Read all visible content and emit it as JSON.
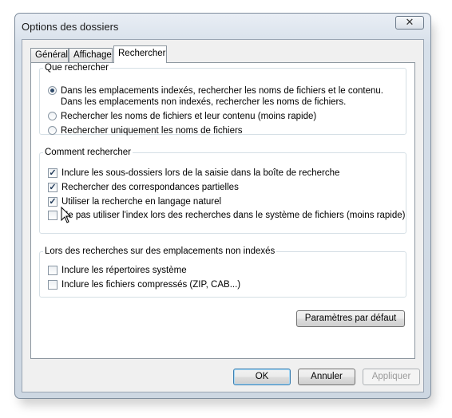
{
  "window": {
    "title": "Options des dossiers",
    "close_glyph": "✕"
  },
  "tabs": [
    {
      "label": "Général"
    },
    {
      "label": "Affichage"
    },
    {
      "label": "Rechercher"
    }
  ],
  "group_what": {
    "legend": "Que rechercher",
    "options": [
      {
        "label": "Dans les emplacements indexés, rechercher les noms de fichiers et le contenu. Dans les emplacements non indexés, rechercher les noms de fichiers.",
        "selected": true
      },
      {
        "label": "Rechercher les noms de fichiers et leur contenu (moins rapide)",
        "selected": false
      },
      {
        "label": "Rechercher uniquement les noms de fichiers",
        "selected": false
      }
    ]
  },
  "group_how": {
    "legend": "Comment rechercher",
    "options": [
      {
        "label": "Inclure les sous-dossiers lors de la saisie dans la boîte de recherche",
        "checked": true
      },
      {
        "label": "Rechercher des correspondances partielles",
        "checked": true
      },
      {
        "label": "Utiliser la recherche en langage naturel",
        "checked": true
      },
      {
        "label": "Ne pas utiliser l'index lors des recherches dans le système de fichiers (moins rapide)",
        "checked": false
      }
    ]
  },
  "group_nonindexed": {
    "legend": "Lors des recherches sur des emplacements non indexés",
    "options": [
      {
        "label": "Inclure les répertoires système",
        "checked": false
      },
      {
        "label": "Inclure les fichiers compressés (ZIP, CAB...)",
        "checked": false
      }
    ]
  },
  "buttons": {
    "defaults": "Paramètres par défaut",
    "ok": "OK",
    "cancel": "Annuler",
    "apply": "Appliquer"
  },
  "check_glyph": "✓"
}
